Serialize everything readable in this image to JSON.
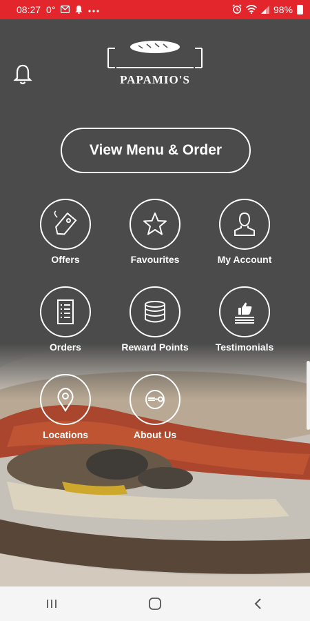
{
  "status_bar": {
    "time": "08:27",
    "temperature": "0°",
    "battery": "98%",
    "icons": [
      "message-icon",
      "notification-icon",
      "more-dots-icon",
      "alarm-icon",
      "wifi-icon",
      "signal-icon",
      "battery-icon"
    ]
  },
  "header": {
    "logo_text": "PAPAMIO'S"
  },
  "cta": {
    "label": "View Menu & Order"
  },
  "tiles": [
    {
      "label": "Offers",
      "icon": "tag-icon"
    },
    {
      "label": "Favourites",
      "icon": "star-icon"
    },
    {
      "label": "My Account",
      "icon": "user-icon"
    },
    {
      "label": "Orders",
      "icon": "list-icon"
    },
    {
      "label": "Reward Points",
      "icon": "coins-icon"
    },
    {
      "label": "Testimonials",
      "icon": "thumbs-up-icon"
    },
    {
      "label": "Locations",
      "icon": "location-pin-icon"
    },
    {
      "label": "About Us",
      "icon": "plate-cutlery-icon"
    }
  ],
  "colors": {
    "status_bar": "#e3252c",
    "background": "#4b4b4b",
    "foreground": "#ffffff",
    "nav_bar": "#f5f5f5"
  }
}
